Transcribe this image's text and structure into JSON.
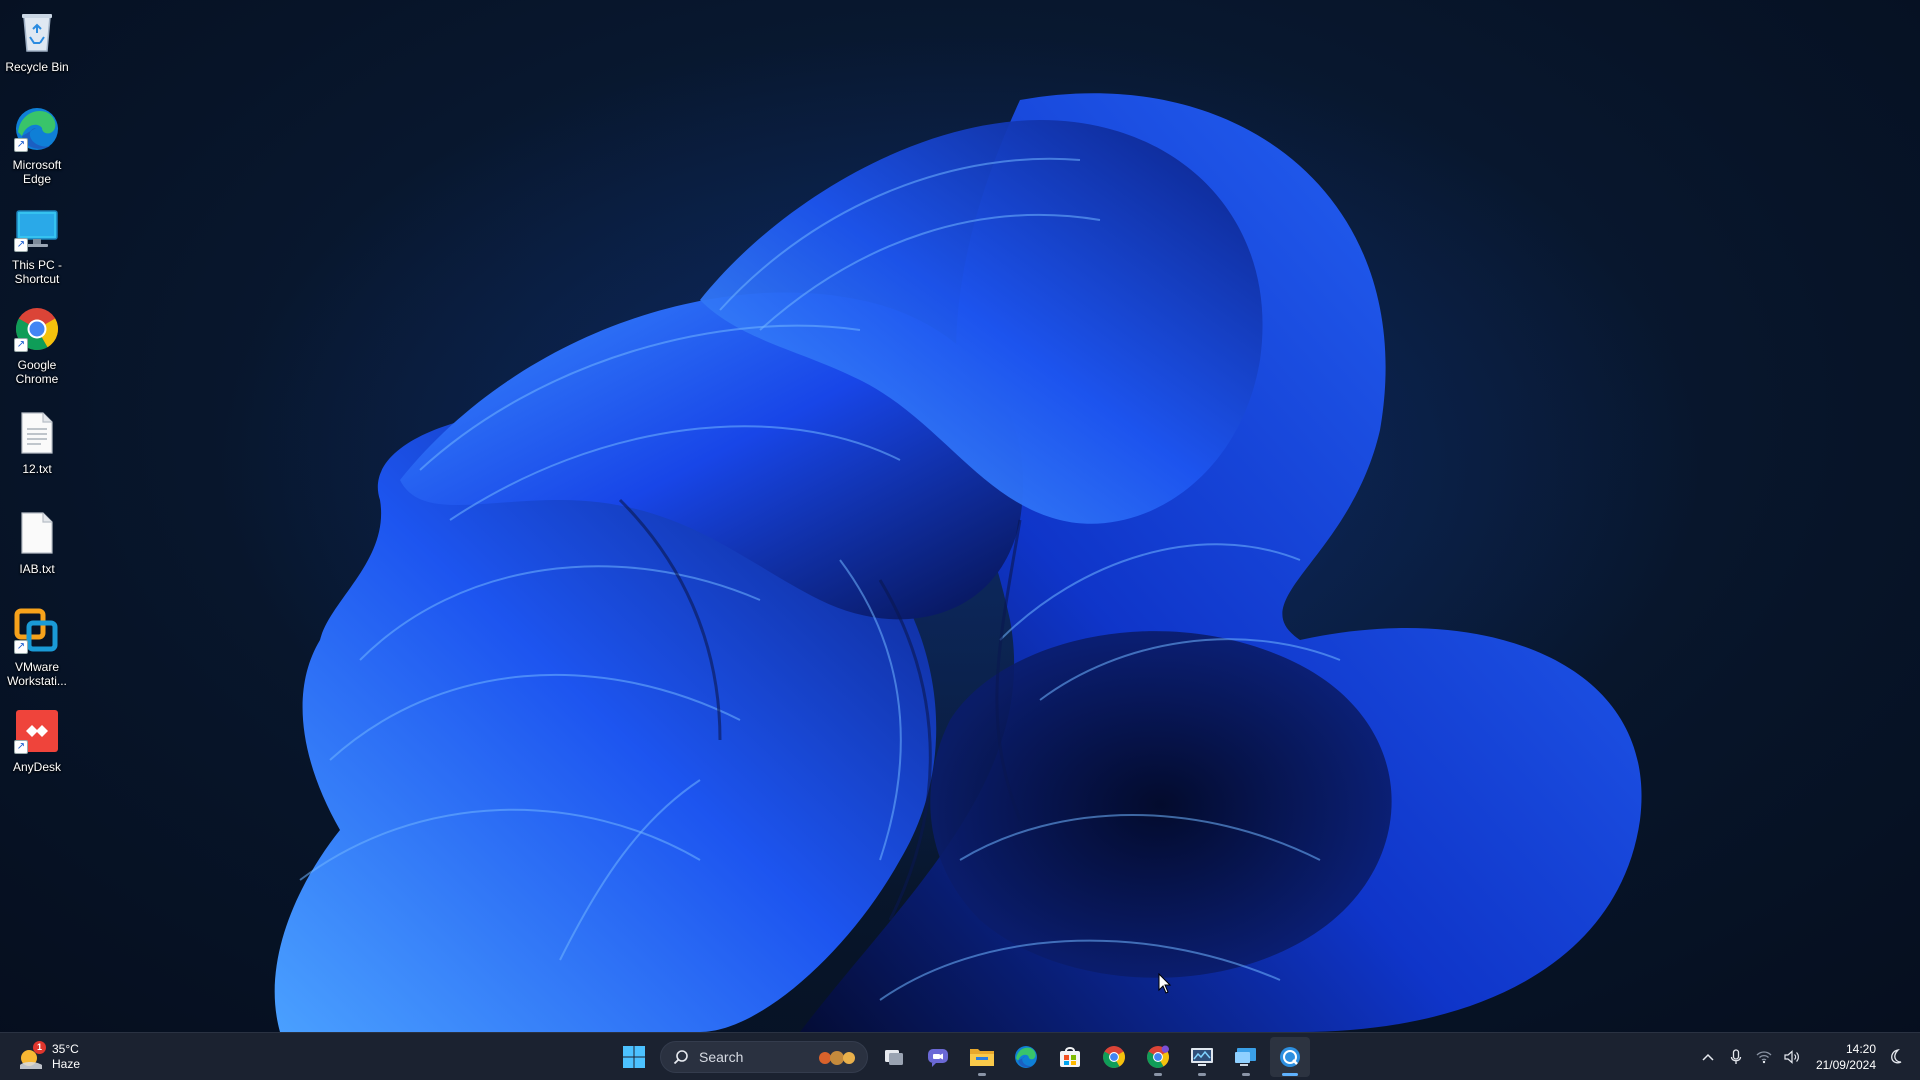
{
  "desktop": {
    "icons": [
      {
        "label": "Recycle Bin",
        "icon": "recycle-bin-icon"
      },
      {
        "label": "Microsoft Edge",
        "icon": "edge-icon"
      },
      {
        "label": "This PC - Shortcut",
        "icon": "this-pc-icon"
      },
      {
        "label": "Google Chrome",
        "icon": "chrome-icon"
      },
      {
        "label": "12.txt",
        "icon": "text-file-icon"
      },
      {
        "label": "IAB.txt",
        "icon": "text-file-icon"
      },
      {
        "label": "VMware Workstati...",
        "icon": "vmware-icon"
      },
      {
        "label": "AnyDesk",
        "icon": "anydesk-icon"
      }
    ],
    "wallpaper": "windows-11-bloom",
    "accent_color": "#1f5cff"
  },
  "taskbar": {
    "weather": {
      "temperature": "35°C",
      "condition": "Haze",
      "badge": "1"
    },
    "search": {
      "label": "Search"
    },
    "apps": [
      {
        "name": "start",
        "icon": "windows-start-icon"
      },
      {
        "name": "task-view",
        "icon": "task-view-icon"
      },
      {
        "name": "chat",
        "icon": "chat-icon"
      },
      {
        "name": "file-explorer",
        "icon": "folder-icon"
      },
      {
        "name": "edge",
        "icon": "edge-icon"
      },
      {
        "name": "store",
        "icon": "store-icon"
      },
      {
        "name": "chrome",
        "icon": "chrome-icon"
      },
      {
        "name": "chrome-profile",
        "icon": "chrome-profile-icon"
      },
      {
        "name": "monitor",
        "icon": "monitor-app-icon"
      },
      {
        "name": "remote-desktop",
        "icon": "remote-desktop-icon"
      },
      {
        "name": "remote-app",
        "icon": "remote-app-icon"
      }
    ],
    "tray": {
      "time": "14:20",
      "date": "21/09/2024"
    }
  }
}
